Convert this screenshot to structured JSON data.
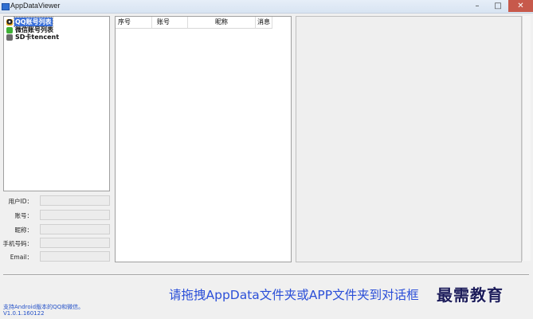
{
  "window": {
    "title": "AppDataViewer",
    "minimize_glyph": "–",
    "maximize_glyph": "□",
    "close_glyph": "✕"
  },
  "tree": {
    "items": [
      {
        "label": "QQ账号列表",
        "icon": "qq-icon",
        "selected": true
      },
      {
        "label": "微信账号列表",
        "icon": "wechat-icon",
        "selected": false
      },
      {
        "label": "SD卡tencent",
        "icon": "sd-card-icon",
        "selected": false
      }
    ]
  },
  "form": {
    "fields": [
      {
        "label": "用户ID：",
        "value": ""
      },
      {
        "label": "账号：",
        "value": ""
      },
      {
        "label": "昵称：",
        "value": ""
      },
      {
        "label": "手机号码：",
        "value": ""
      },
      {
        "label": "Email：",
        "value": ""
      }
    ]
  },
  "list": {
    "columns": [
      "序号",
      "账号",
      "昵称",
      "消息"
    ],
    "rows": []
  },
  "footer": {
    "hint": "请拖拽AppData文件夹或APP文件夹到对话框",
    "watermark": "最需教育",
    "support": "支持Android版本的QQ和微信。",
    "version": "V1.0.1.160122"
  }
}
